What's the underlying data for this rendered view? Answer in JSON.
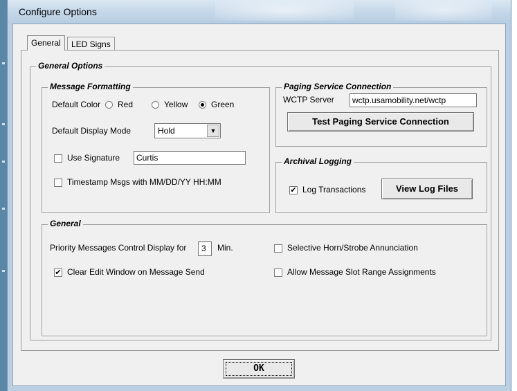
{
  "window": {
    "title": "Configure Options"
  },
  "tabs": [
    {
      "label": "General"
    },
    {
      "label": "LED Signs"
    }
  ],
  "general_options": {
    "title": "General Options",
    "message_formatting": {
      "title": "Message Formatting",
      "default_color_label": "Default Color",
      "colors": [
        {
          "label": "Red",
          "selected": false
        },
        {
          "label": "Yellow",
          "selected": false
        },
        {
          "label": "Green",
          "selected": true
        }
      ],
      "default_display_mode_label": "Default Display Mode",
      "default_display_mode_value": "Hold",
      "use_signature_label": "Use Signature",
      "use_signature_checked": false,
      "signature_value": "Curtis",
      "timestamp_label": "Timestamp Msgs with MM/DD/YY HH:MM",
      "timestamp_checked": false
    },
    "paging": {
      "title": "Paging Service Connection",
      "wctp_label": "WCTP Server",
      "wctp_value": "wctp.usamobility.net/wctp",
      "test_button": "Test Paging Service Connection"
    },
    "archival": {
      "title": "Archival Logging",
      "log_label": "Log Transactions",
      "log_checked": true,
      "view_button": "View Log Files"
    },
    "general": {
      "title": "General",
      "priority_label": "Priority Messages Control Display for",
      "priority_value": "3",
      "priority_unit": "Min.",
      "clear_edit_label": "Clear Edit Window on Message Send",
      "clear_edit_checked": true,
      "selective_horn_label": "Selective Horn/Strobe Annunciation",
      "selective_horn_checked": false,
      "allow_slot_label": "Allow Message Slot Range Assignments",
      "allow_slot_checked": false
    }
  },
  "footer": {
    "ok_label": "OK"
  }
}
